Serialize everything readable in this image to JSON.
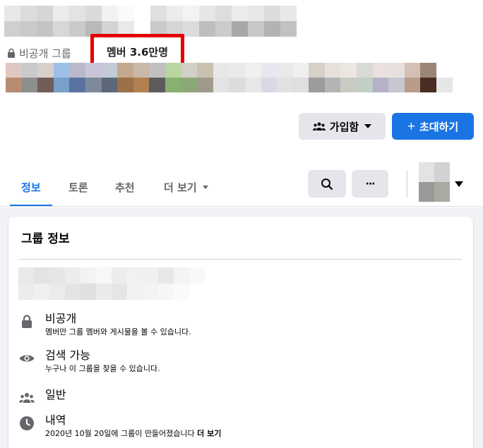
{
  "group": {
    "privacy_label": "비공개 그룹",
    "members_label": "멤버 3.6만명"
  },
  "actions": {
    "join_label": "가입함",
    "invite_label": "초대하기",
    "invite_prefix": "+"
  },
  "tabs": [
    {
      "label": "정보",
      "active": true
    },
    {
      "label": "토론",
      "active": false
    },
    {
      "label": "추천",
      "active": false
    },
    {
      "label": "더 보기",
      "active": false
    }
  ],
  "toolbar": {
    "more_glyph": "···"
  },
  "about": {
    "title": "그룹 정보",
    "items": [
      {
        "icon": "lock-icon",
        "heading": "비공개",
        "detail": "멤버만 그룹 멤버와 게시물을 볼 수 있습니다."
      },
      {
        "icon": "eye-icon",
        "heading": "검색 가능",
        "detail": "누구나 이 그룹을 찾을 수 있습니다."
      },
      {
        "icon": "people-icon",
        "heading": "일반",
        "detail": ""
      },
      {
        "icon": "clock-icon",
        "heading": "내역",
        "detail": "2020년 10월 20일에 그룹이 만들어졌습니다",
        "detail_link": "더 보기"
      }
    ]
  },
  "colors": {
    "accent": "#1b74e4",
    "highlight_box": "#e40000",
    "secondary_button": "#e4e6eb",
    "muted_text": "#65676b",
    "page_background": "#f0f2f5"
  },
  "redacted": {
    "title_tones": [
      "#e8e8e8",
      "#dcdcdc",
      "#d6d6d6",
      "#ececec",
      "#e3e3e3",
      "#dadada",
      "#f2f2f2",
      "#fafafa",
      "#ffffff",
      "#dfdfdf",
      "#ececec",
      "#f3f3f3",
      "#e6e6e6",
      "#dddddd",
      "#ececec",
      "#e7e7e7",
      "#dcdcdc",
      "#e9e9e9",
      "#cfcfcf",
      "#c9c9c9",
      "#c4c4c4",
      "#d7d7d7",
      "#cacaca",
      "#b9b9b9",
      "#d3d3d3",
      "#e9e9e9",
      "#ffffff",
      "#c9c9c9",
      "#d5d5d5",
      "#dcdcdc",
      "#bebebe",
      "#cbcbcb",
      "#a8a8a8",
      "#c7c7c7",
      "#b3b3b3",
      "#c2c2c2"
    ],
    "avatar_tones": [
      "#e0c8c0",
      "#c9c9c9",
      "#d8d0cc",
      "#9cc0e8",
      "#b9b9c9",
      "#c9c4d9",
      "#c2cbd6",
      "#c4a98e",
      "#c9b9a9",
      "#c0c0c0",
      "#b9d6a0",
      "#d0d0c6",
      "#c9c1b0",
      "#e8e8e8",
      "#eaeaea",
      "#f0f0f0",
      "#e7e7ee",
      "#e9e9e9",
      "#f0f0f0",
      "#d6d0c9",
      "#e5e0dc",
      "#ece6e0",
      "#d9d9d6",
      "#ebdfe0",
      "#e8e0df",
      "#d4c0b4",
      "#9b8579",
      "#ffffff",
      "#ffffff",
      "#b88c70",
      "#8d8d8d",
      "#725e58",
      "#78a0c8",
      "#5a72a0",
      "#7c8a9c",
      "#5c6878",
      "#9c7048",
      "#b08050",
      "#5c5c5c",
      "#88b070",
      "#8ca878",
      "#a09a8c",
      "#e3e3e3",
      "#dcdcdc",
      "#e7e7e7",
      "#d9d9e5",
      "#e2e2e2",
      "#dfdfdf",
      "#9c9c9c",
      "#b4b4b4",
      "#c8cbc2",
      "#c0d0c6",
      "#b6b0c8",
      "#c7c7cf",
      "#b89c8a",
      "#4a2c24",
      "#e6e6e6",
      "#ffffff",
      "#ffffff"
    ],
    "desc_tones": [
      "#e9e9e9",
      "#e3e3e3",
      "#e6e6e6",
      "#ececec",
      "#f3f3f3",
      "#f7f7f7",
      "#ededed",
      "#f1f1f1",
      "#f0f0f0",
      "#e7e7e7",
      "#f4f4f4",
      "#f8f8f8",
      "#ffffff",
      "#ececec",
      "#efefef",
      "#ebebeb",
      "#e4e4e4",
      "#e0e0e0",
      "#ebebeb",
      "#e5e5e5",
      "#f2f2f2",
      "#f3f3f3",
      "#f6f6f6",
      "#fafafa",
      "#ffffff",
      "#ffffff"
    ],
    "thumb_tones": [
      "#e3e3e3",
      "#d2d2d2",
      "#9a9a9a",
      "#aaaaa0"
    ]
  }
}
